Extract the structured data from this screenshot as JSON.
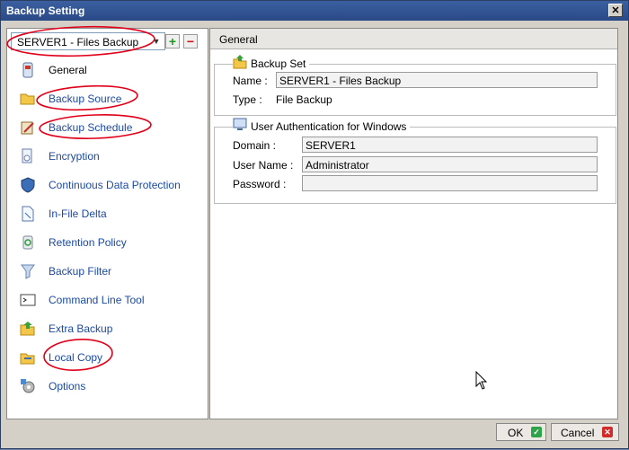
{
  "window": {
    "title": "Backup Setting",
    "close_glyph": "✕"
  },
  "sidebar": {
    "backup_set_selected": "SERVER1 - Files Backup",
    "add_glyph": "+",
    "remove_glyph": "−",
    "items": [
      {
        "label": "General",
        "icon": "general-icon"
      },
      {
        "label": "Backup Source",
        "icon": "folder-open-icon"
      },
      {
        "label": "Backup Schedule",
        "icon": "schedule-icon"
      },
      {
        "label": "Encryption",
        "icon": "key-icon"
      },
      {
        "label": "Continuous Data Protection",
        "icon": "shield-icon"
      },
      {
        "label": "In-File Delta",
        "icon": "document-icon"
      },
      {
        "label": "Retention Policy",
        "icon": "recycle-icon"
      },
      {
        "label": "Backup Filter",
        "icon": "funnel-icon"
      },
      {
        "label": "Command Line Tool",
        "icon": "terminal-icon"
      },
      {
        "label": "Extra Backup",
        "icon": "extra-backup-icon"
      },
      {
        "label": "Local Copy",
        "icon": "folder-copy-icon"
      },
      {
        "label": "Options",
        "icon": "gear-icon"
      }
    ]
  },
  "main": {
    "title": "General",
    "backup_set": {
      "title": "Backup Set",
      "name_label": "Name :",
      "name_value": "SERVER1 - Files Backup",
      "type_label": "Type :",
      "type_value": "File Backup"
    },
    "auth": {
      "title": "User Authentication for Windows",
      "domain_label": "Domain :",
      "domain_value": "SERVER1",
      "username_label": "User Name :",
      "username_value": "Administrator",
      "password_label": "Password :",
      "password_value": ""
    }
  },
  "footer": {
    "ok_label": "OK",
    "cancel_label": "Cancel"
  },
  "colors": {
    "title_bar": "#2a4a86",
    "nav_text": "#1c4aa0",
    "annotation": "#e0001a"
  }
}
